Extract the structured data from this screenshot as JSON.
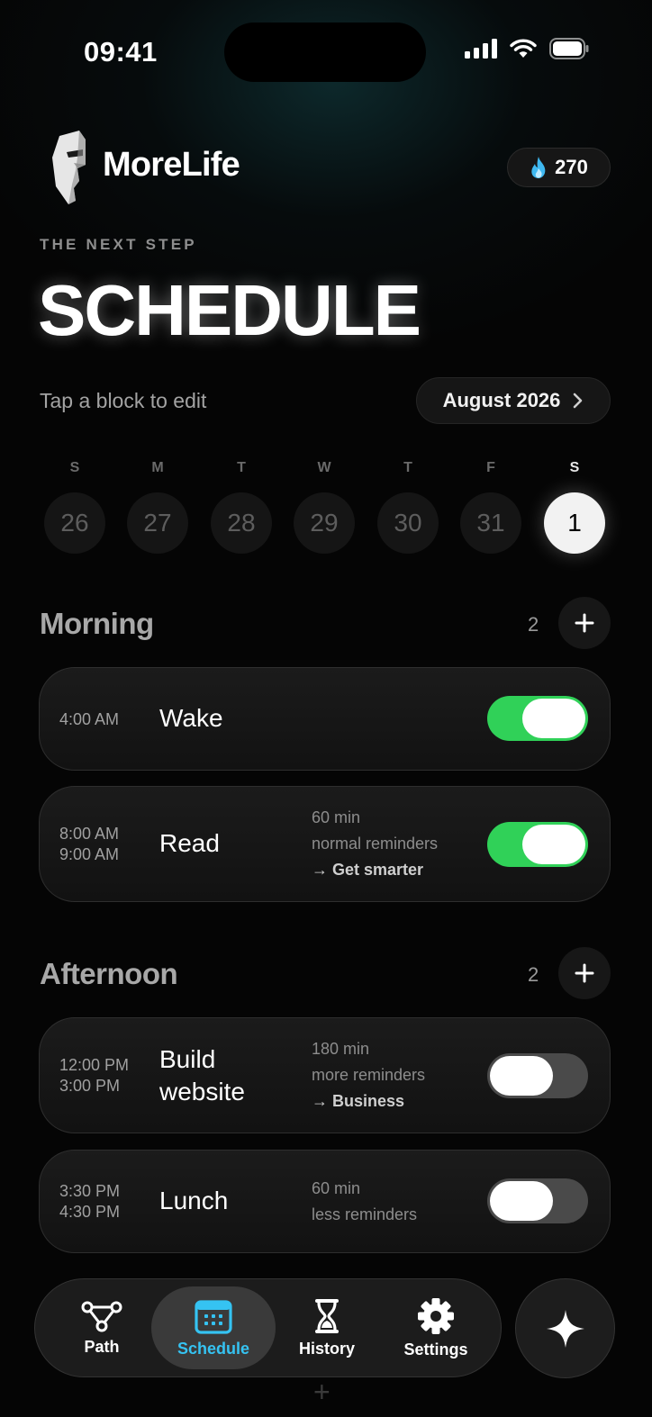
{
  "status_bar": {
    "time": "09:41"
  },
  "header": {
    "brand": "MoreLife",
    "streak_count": "270",
    "streak_icon": "flame-icon"
  },
  "eyebrow": "THE NEXT STEP",
  "page_title": "SCHEDULE",
  "hint": "Tap a block to edit",
  "month": {
    "label": "August 2026",
    "icon": "chevron-right-icon"
  },
  "week": [
    {
      "letter": "S",
      "day": "26",
      "selected": false
    },
    {
      "letter": "M",
      "day": "27",
      "selected": false
    },
    {
      "letter": "T",
      "day": "28",
      "selected": false
    },
    {
      "letter": "W",
      "day": "29",
      "selected": false
    },
    {
      "letter": "T",
      "day": "30",
      "selected": false
    },
    {
      "letter": "F",
      "day": "31",
      "selected": false
    },
    {
      "letter": "S",
      "day": "1",
      "selected": true
    }
  ],
  "sections": [
    {
      "title": "Morning",
      "count": "2",
      "blocks": [
        {
          "start": "4:00 AM",
          "end": "",
          "name": "Wake",
          "duration": "",
          "reminders": "",
          "goal": "",
          "enabled": true
        },
        {
          "start": "8:00 AM",
          "end": "9:00 AM",
          "name": "Read",
          "duration": "60 min",
          "reminders": "normal reminders",
          "goal": "→ Get smarter",
          "enabled": true
        }
      ]
    },
    {
      "title": "Afternoon",
      "count": "2",
      "blocks": [
        {
          "start": "12:00 PM",
          "end": "3:00 PM",
          "name": "Build website",
          "duration": "180 min",
          "reminders": "more reminders",
          "goal": "→ Business",
          "enabled": false
        },
        {
          "start": "3:30 PM",
          "end": "4:30 PM",
          "name": "Lunch",
          "duration": "60 min",
          "reminders": "less reminders",
          "goal": "",
          "enabled": false
        }
      ]
    }
  ],
  "tabbar": {
    "tabs": [
      {
        "label": "Path",
        "icon": "path-nodes-icon",
        "active": false
      },
      {
        "label": "Schedule",
        "icon": "calendar-icon",
        "active": true
      },
      {
        "label": "History",
        "icon": "hourglass-icon",
        "active": false
      },
      {
        "label": "Settings",
        "icon": "gear-icon",
        "active": false
      }
    ],
    "fab_icon": "sparkle-icon"
  },
  "colors": {
    "toggle_on": "#30d158",
    "toggle_off": "#4a4a4a",
    "tab_active": "#35c3f2",
    "flame": "#3fb8f0",
    "background": "#050505"
  }
}
